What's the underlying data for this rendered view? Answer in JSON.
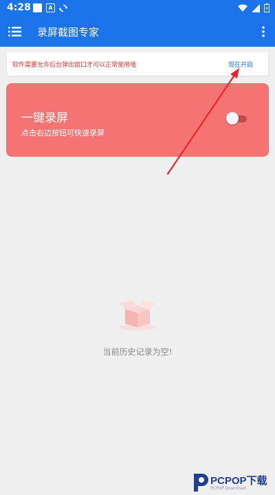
{
  "status_bar": {
    "time": "4:28",
    "icons": [
      "square-icon",
      "a-badge-icon",
      "sync-icon",
      "wifi-icon",
      "signal-icon",
      "battery-icon"
    ],
    "color": "#1a73e8"
  },
  "app_bar": {
    "title": "录屏截图专家",
    "menu_icon": "menu-icon",
    "more_icon": "more-vertical-icon"
  },
  "notice": {
    "text": "软件需要允许后台弹出窗口才可以正常使用哦",
    "action_label": "现在开启",
    "text_color": "#e0362c",
    "action_color": "#1a73e8"
  },
  "record_card": {
    "title": "一键录屏",
    "subtitle": "点击右边按钮可快速录屏",
    "toggle_on": false,
    "color": "#f47474"
  },
  "empty_state": {
    "icon": "empty-box-icon",
    "text": "当前历史记录为空!"
  },
  "watermark": {
    "text": "PCPOP下载",
    "sub": "PCPOP Download"
  }
}
